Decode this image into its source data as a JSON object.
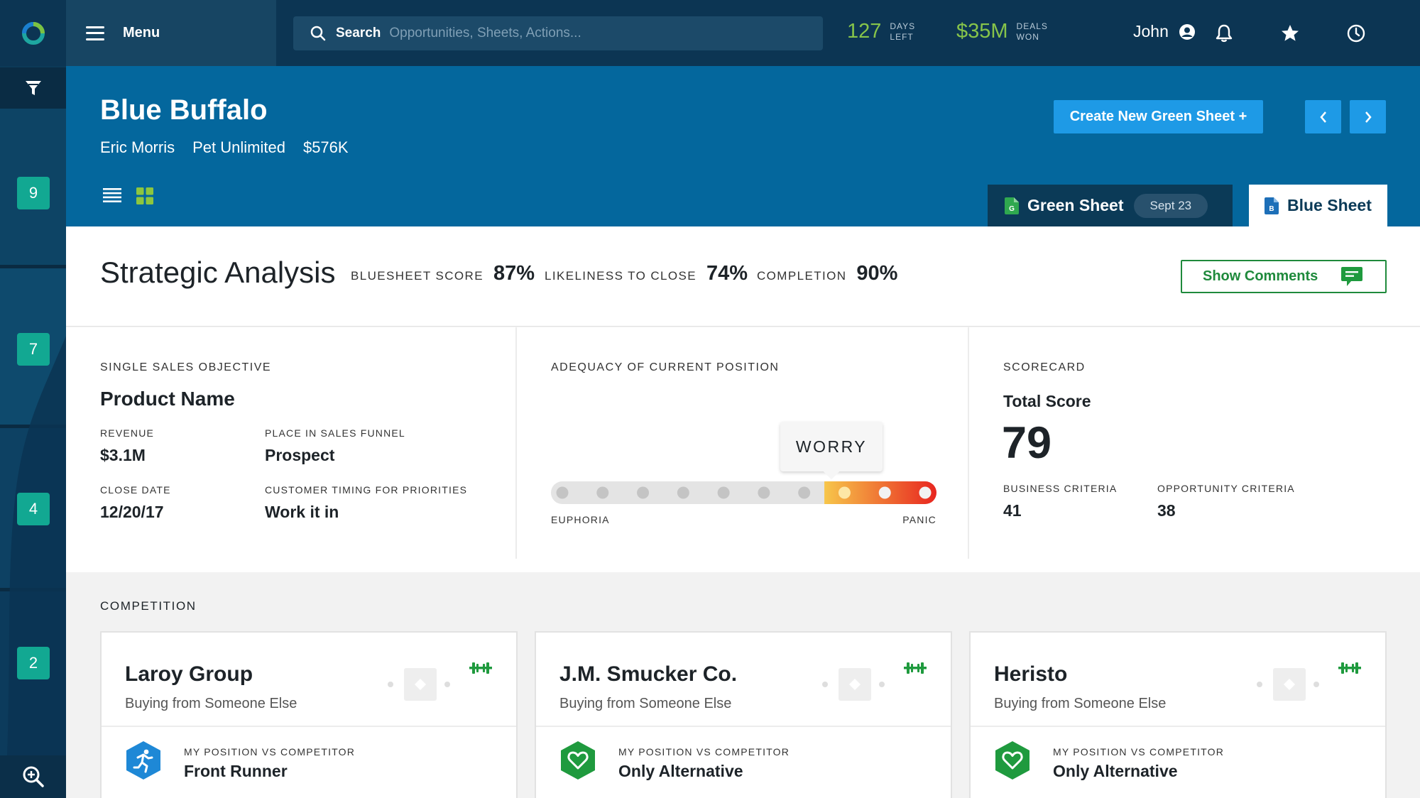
{
  "topbar": {
    "menu_label": "Menu",
    "search_label": "Search",
    "search_placeholder": "Opportunities, Sheets, Actions...",
    "days_left_value": "127",
    "days_left_line1": "DAYS",
    "days_left_line2": "LEFT",
    "deals_won_value": "$35M",
    "deals_won_line1": "DEALS",
    "deals_won_line2": "WON",
    "user_name": "John"
  },
  "rail": {
    "stages": [
      "9",
      "7",
      "4",
      "2"
    ]
  },
  "header": {
    "title": "Blue Buffalo",
    "contact": "Eric Morris",
    "company": "Pet Unlimited",
    "amount": "$576K",
    "create_button": "Create New Green Sheet +",
    "tab_green": "Green Sheet",
    "tab_green_date": "Sept 23",
    "tab_blue": "Blue Sheet",
    "green_doc_letter": "G",
    "blue_doc_letter": "B"
  },
  "analysis": {
    "title": "Strategic Analysis",
    "bluesheet_score_label": "BLUESHEET SCORE",
    "bluesheet_score": "87%",
    "likeliness_label": "LIKELINESS TO CLOSE",
    "likeliness": "74%",
    "completion_label": "COMPLETION",
    "completion": "90%",
    "show_comments": "Show Comments"
  },
  "objective": {
    "caption": "SINGLE SALES OBJECTIVE",
    "product": "Product Name",
    "revenue_label": "REVENUE",
    "revenue": "$3.1M",
    "funnel_label": "PLACE IN SALES FUNNEL",
    "funnel": "Prospect",
    "close_label": "CLOSE DATE",
    "close_date": "12/20/17",
    "timing_label": "CUSTOMER TIMING FOR PRIORITIES",
    "timing": "Work it in"
  },
  "adequacy": {
    "caption": "ADEQUACY OF CURRENT POSITION",
    "tooltip": "WORRY",
    "left_label": "EUPHORIA",
    "right_label": "PANIC",
    "steps": 10,
    "selected_step": 8,
    "colors": {
      "track": "#e4e4e4",
      "dot": "#c4c4c4",
      "warm_start": "#f7c64a",
      "warm_end": "#e8251f"
    }
  },
  "scorecard": {
    "caption": "SCORECARD",
    "total_label": "Total Score",
    "total": "79",
    "business_label": "BUSINESS CRITERIA",
    "business": "41",
    "opportunity_label": "OPPORTUNITY CRITERIA",
    "opportunity": "38"
  },
  "competition": {
    "title": "COMPETITION",
    "position_caption": "MY POSITION VS COMPETITOR",
    "cards": [
      {
        "name": "Laroy Group",
        "status": "Buying from Someone Else",
        "position": "Front Runner",
        "icon": "runner-icon",
        "icon_color": "#1e88d6"
      },
      {
        "name": "J.M. Smucker Co.",
        "status": "Buying from Someone Else",
        "position": "Only Alternative",
        "icon": "heart-shield-icon",
        "icon_color": "#1f9a3e"
      },
      {
        "name": "Heristo",
        "status": "Buying from Someone Else",
        "position": "Only Alternative",
        "icon": "heart-shield-icon",
        "icon_color": "#1f9a3e"
      }
    ]
  },
  "colors": {
    "nav_dark": "#0c3553",
    "header_blue": "#04679d",
    "action_blue": "#1e9ae6",
    "kpi_green": "#86c44a",
    "stage_teal": "#12a892",
    "comment_green": "#1f8a3c"
  }
}
